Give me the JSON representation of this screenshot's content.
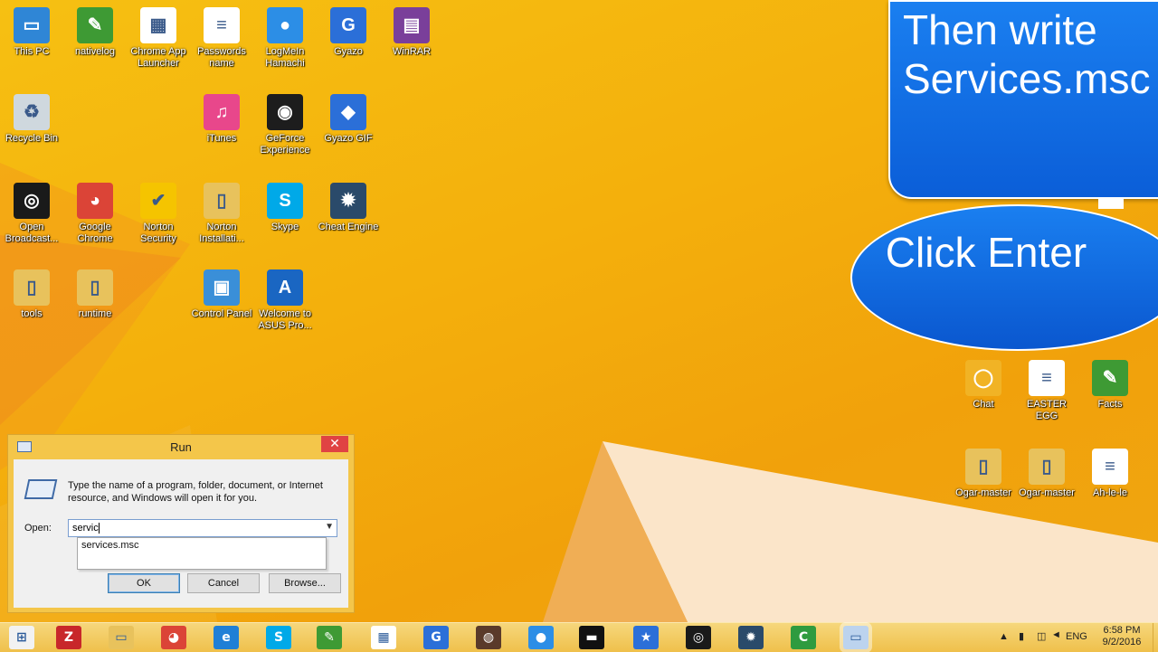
{
  "desktop_icons": [
    {
      "label": "This PC",
      "icon": "monitor-icon",
      "color": "#2f86d6",
      "glyph": "▭"
    },
    {
      "label": "nativelog",
      "icon": "notepad-icon",
      "color": "#3e9a34",
      "glyph": "✎"
    },
    {
      "label": "Chrome App Launcher",
      "icon": "app-launcher-icon",
      "color": "#ffffff",
      "glyph": "▦"
    },
    {
      "label": "Passwords name",
      "icon": "text-file-icon",
      "color": "#ffffff",
      "glyph": "≡"
    },
    {
      "label": "LogMeIn Hamachi",
      "icon": "hamachi-icon",
      "color": "#2c8ee6",
      "glyph": "●"
    },
    {
      "label": "Gyazo",
      "icon": "gyazo-icon",
      "color": "#2b6fd8",
      "glyph": "G"
    },
    {
      "label": "WinRAR",
      "icon": "winrar-icon",
      "color": "#7a3f9a",
      "glyph": "▤"
    },
    {
      "label": "Recycle Bin",
      "icon": "recycle-bin-icon",
      "color": "#cfd8de",
      "glyph": "♻"
    },
    {
      "label": "iTunes",
      "icon": "itunes-icon",
      "color": "#e8478b",
      "glyph": "♫"
    },
    {
      "label": "GeForce Experience",
      "icon": "geforce-icon",
      "color": "#1d1d1d",
      "glyph": "◉"
    },
    {
      "label": "Gyazo GIF",
      "icon": "gyazo-gif-icon",
      "color": "#2b6fd8",
      "glyph": "◆"
    },
    {
      "label": "Open Broadcast...",
      "icon": "obs-icon",
      "color": "#1a1a1a",
      "glyph": "◎"
    },
    {
      "label": "Google Chrome",
      "icon": "chrome-icon",
      "color": "#db4437",
      "glyph": "◕"
    },
    {
      "label": "Norton Security",
      "icon": "norton-icon",
      "color": "#f5c400",
      "glyph": "✔"
    },
    {
      "label": "Norton Installati...",
      "icon": "folder-icon",
      "color": "#e8c25c",
      "glyph": "▯"
    },
    {
      "label": "Skype",
      "icon": "skype-icon",
      "color": "#00a9e8",
      "glyph": "S"
    },
    {
      "label": "Cheat Engine",
      "icon": "cheat-engine-icon",
      "color": "#2a4a6a",
      "glyph": "✹"
    },
    {
      "label": "tools",
      "icon": "folder-icon",
      "color": "#e8c25c",
      "glyph": "▯"
    },
    {
      "label": "runtime",
      "icon": "folder-icon",
      "color": "#e8c25c",
      "glyph": "▯"
    },
    {
      "label": "Control Panel",
      "icon": "control-panel-icon",
      "color": "#3a8fd8",
      "glyph": "▣"
    },
    {
      "label": "Welcome to ASUS Pro...",
      "icon": "asus-icon",
      "color": "#1a66c2",
      "glyph": "A"
    },
    {
      "label": "Chat",
      "icon": "chrome-chat-icon",
      "color": "#f1b325",
      "glyph": "◯"
    },
    {
      "label": "EASTER EGG",
      "icon": "text-file-icon",
      "color": "#ffffff",
      "glyph": "≡"
    },
    {
      "label": "Facts",
      "icon": "notepad-icon",
      "color": "#3e9a34",
      "glyph": "✎"
    },
    {
      "label": "Ogar-master",
      "icon": "folder-icon",
      "color": "#e8c25c",
      "glyph": "▯"
    },
    {
      "label": "Ogar-master",
      "icon": "zip-folder-icon",
      "color": "#e8c25c",
      "glyph": "▯"
    },
    {
      "label": "Ah-le-le",
      "icon": "text-file-icon",
      "color": "#ffffff",
      "glyph": "≡"
    }
  ],
  "callouts": {
    "line1": "Then write",
    "line2": "Services.msc",
    "enter": "Click Enter"
  },
  "run_dialog": {
    "title": "Run",
    "close": "✕",
    "description": "Type the name of a program, folder, document, or Internet resource, and Windows will open it for you.",
    "open_label": "Open:",
    "open_value": "servic",
    "suggestion": "services.msc",
    "ok": "OK",
    "cancel": "Cancel",
    "browse": "Browse..."
  },
  "taskbar": {
    "items": [
      {
        "icon": "windows-start-icon",
        "color": "#f2f2f2",
        "glyph": "⊞"
      },
      {
        "icon": "filezilla-icon",
        "color": "#c8272a",
        "glyph": "Z"
      },
      {
        "icon": "file-explorer-icon",
        "color": "#e8c25c",
        "glyph": "▭"
      },
      {
        "icon": "chrome-icon",
        "color": "#db4437",
        "glyph": "◕"
      },
      {
        "icon": "internet-explorer-icon",
        "color": "#1f7fd6",
        "glyph": "e"
      },
      {
        "icon": "skype-icon",
        "color": "#00a9e8",
        "glyph": "S"
      },
      {
        "icon": "notepad-plus-icon",
        "color": "#3e9a34",
        "glyph": "✎"
      },
      {
        "icon": "app-launcher-icon",
        "color": "#ffffff",
        "glyph": "▦"
      },
      {
        "icon": "gyazo-icon",
        "color": "#2b6fd8",
        "glyph": "G"
      },
      {
        "icon": "game-icon",
        "color": "#5a3a2a",
        "glyph": "◍"
      },
      {
        "icon": "hamachi-icon",
        "color": "#2c8ee6",
        "glyph": "●"
      },
      {
        "icon": "command-prompt-icon",
        "color": "#111111",
        "glyph": "▬"
      },
      {
        "icon": "star-app-icon",
        "color": "#2b6fd8",
        "glyph": "★"
      },
      {
        "icon": "obs-icon",
        "color": "#1a1a1a",
        "glyph": "◎"
      },
      {
        "icon": "cheat-engine-icon",
        "color": "#2a4a6a",
        "glyph": "✹"
      },
      {
        "icon": "camtasia-icon",
        "color": "#2f9b3f",
        "glyph": "C"
      },
      {
        "icon": "run-icon",
        "color": "#bcd3ee",
        "glyph": "▭"
      }
    ],
    "language": "ENG",
    "time": "6:58 PM",
    "date": "9/2/2016"
  }
}
